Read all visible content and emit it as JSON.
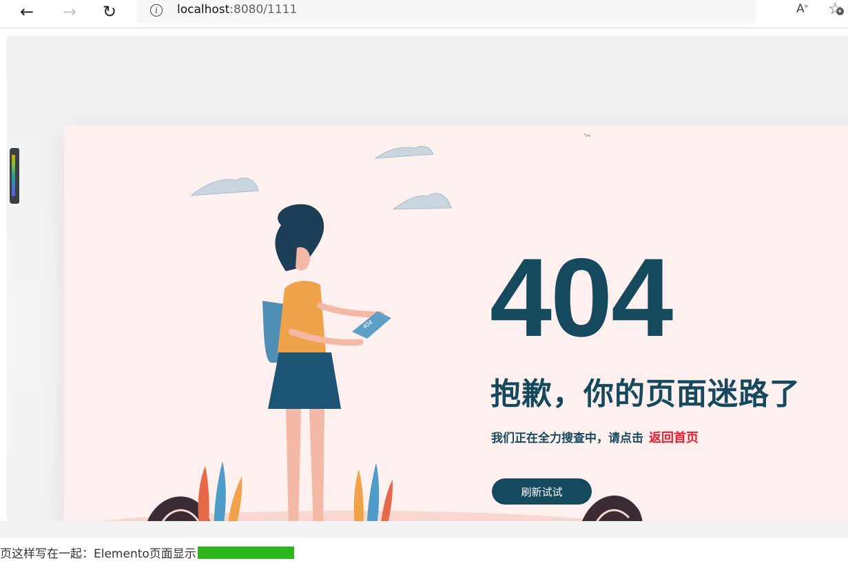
{
  "browser": {
    "back_glyph": "←",
    "forward_glyph": "→",
    "reload_glyph": "↻",
    "info_glyph": "i",
    "url_host": "localhost",
    "url_rest": ":8080/1111",
    "read_aloud_label": "A",
    "read_aloud_sup": "»",
    "favorite_glyph": "☆",
    "favorite_plus": "+"
  },
  "error_page": {
    "code": "404",
    "headline": "抱歉，你的页面迷路了",
    "subline": "我们正在全力搜查中，请点击",
    "home_link": "返回首页",
    "refresh_button": "刷新试试",
    "tablet_text": "404"
  },
  "footer": {
    "partial_text": "页这样写在一起：Elemento页面显示"
  },
  "colors": {
    "accent": "#15495e",
    "link": "#ef1a2d",
    "card_bg": "#fef0ee",
    "highlight": "#2fb51e"
  }
}
